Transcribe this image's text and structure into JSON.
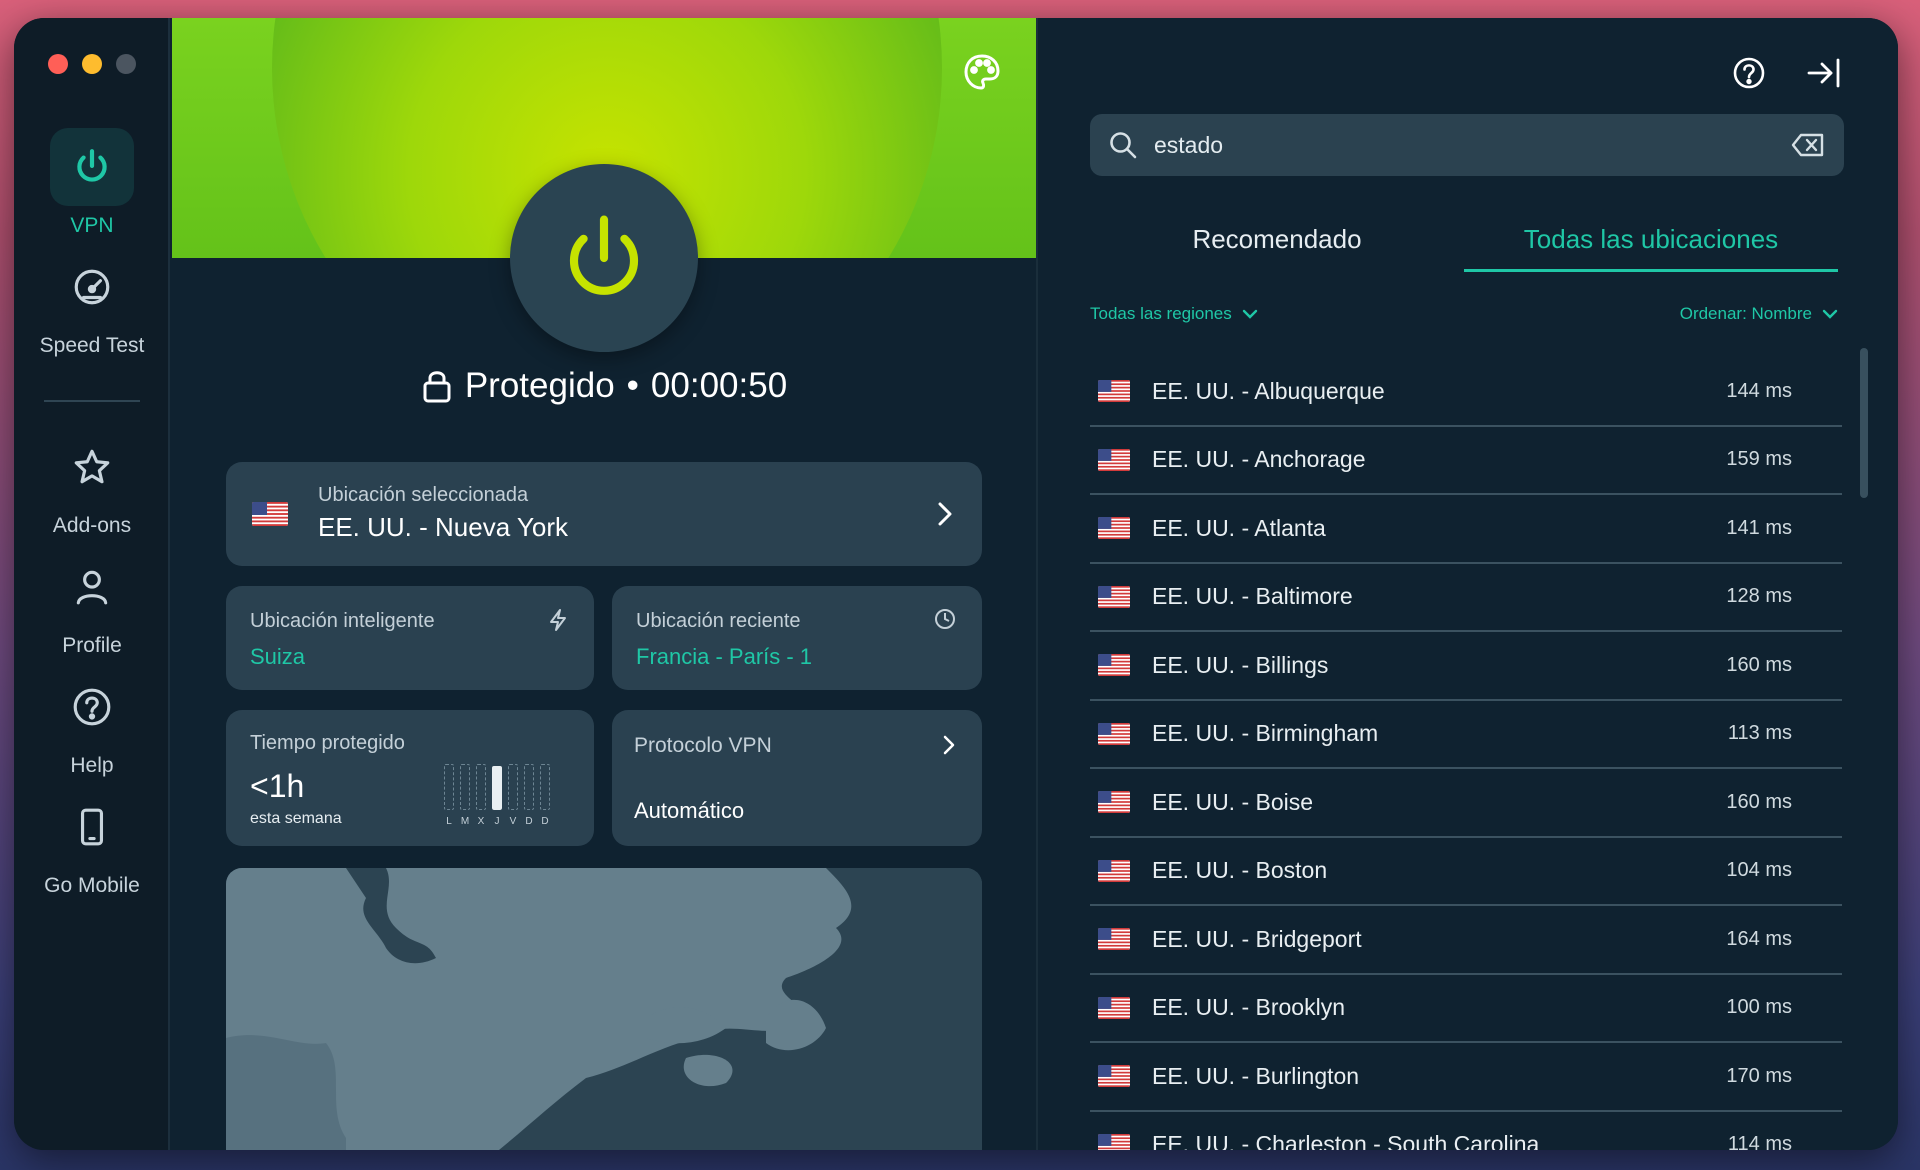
{
  "app": {
    "accent": "#1fc7a6",
    "traffic_colors": [
      "#ff5f57",
      "#febc2e",
      "#4b5560"
    ]
  },
  "sidebar": {
    "items": [
      {
        "label": "VPN",
        "icon": "power-icon"
      },
      {
        "label": "Speed Test",
        "icon": "speedometer-icon"
      },
      {
        "label": "Add-ons",
        "icon": "star-icon"
      },
      {
        "label": "Profile",
        "icon": "person-icon"
      },
      {
        "label": "Help",
        "icon": "question-icon"
      },
      {
        "label": "Go Mobile",
        "icon": "phone-icon"
      }
    ]
  },
  "status": {
    "text": "Protegido",
    "separator": "•",
    "timer": "00:00:50"
  },
  "selected_location": {
    "label": "Ubicación seleccionada",
    "value": "EE. UU. - Nueva York"
  },
  "smart_location": {
    "label": "Ubicación inteligente",
    "value": "Suiza"
  },
  "recent_location": {
    "label": "Ubicación reciente",
    "value": "Francia - París - 1"
  },
  "protected_time": {
    "label": "Tiempo protegido",
    "value": "<1h",
    "sub": "esta semana",
    "days": [
      "L",
      "M",
      "X",
      "J",
      "V",
      "D",
      "D"
    ],
    "active_day_index": 3,
    "active_day_level": 0.95
  },
  "protocol": {
    "label": "Protocolo VPN",
    "value": "Automático"
  },
  "search": {
    "value": "estado"
  },
  "tabs": [
    {
      "label": "Recomendado",
      "active": false
    },
    {
      "label": "Todas las ubicaciones",
      "active": true
    }
  ],
  "filters": {
    "region": "Todas las regiones",
    "sort": "Ordenar: Nombre"
  },
  "locations": [
    {
      "name": "EE. UU. - Albuquerque",
      "ping": "144 ms"
    },
    {
      "name": "EE. UU. - Anchorage",
      "ping": "159 ms"
    },
    {
      "name": "EE. UU. - Atlanta",
      "ping": "141 ms"
    },
    {
      "name": "EE. UU. - Baltimore",
      "ping": "128 ms"
    },
    {
      "name": "EE. UU. - Billings",
      "ping": "160 ms"
    },
    {
      "name": "EE. UU. - Birmingham",
      "ping": "113 ms"
    },
    {
      "name": "EE. UU. - Boise",
      "ping": "160 ms"
    },
    {
      "name": "EE. UU. - Boston",
      "ping": "104 ms"
    },
    {
      "name": "EE. UU. - Bridgeport",
      "ping": "164 ms"
    },
    {
      "name": "EE. UU. - Brooklyn",
      "ping": "100 ms"
    },
    {
      "name": "EE. UU. - Burlington",
      "ping": "170 ms"
    },
    {
      "name": "EE. UU. - Charleston - South Carolina",
      "ping": "114 ms"
    }
  ]
}
